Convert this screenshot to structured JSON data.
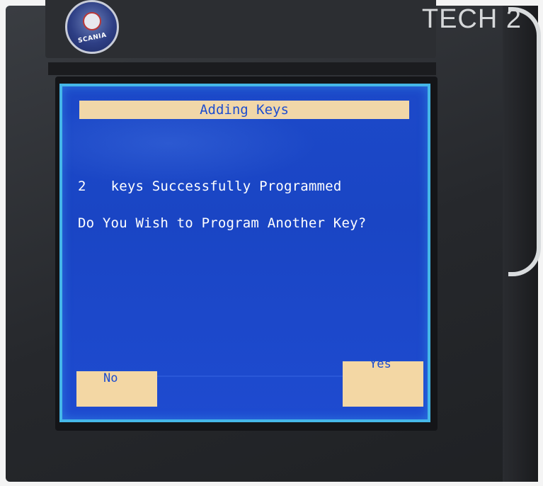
{
  "device": {
    "brand_logo_text": "SCANIA",
    "model_label": "TECH 2"
  },
  "screen": {
    "title": "Adding Keys",
    "keys_count": "2",
    "keys_message": "keys Successfully Programmed",
    "question": "Do You Wish to Program Another Key?"
  },
  "softkeys": {
    "no_label": "No",
    "yes_label": "Yes"
  },
  "colors": {
    "screen_blue": "#1c49c9",
    "title_bar": "#f1d7a8",
    "softkey": "#f3d7a4",
    "lcd_border": "#45b7e8"
  }
}
